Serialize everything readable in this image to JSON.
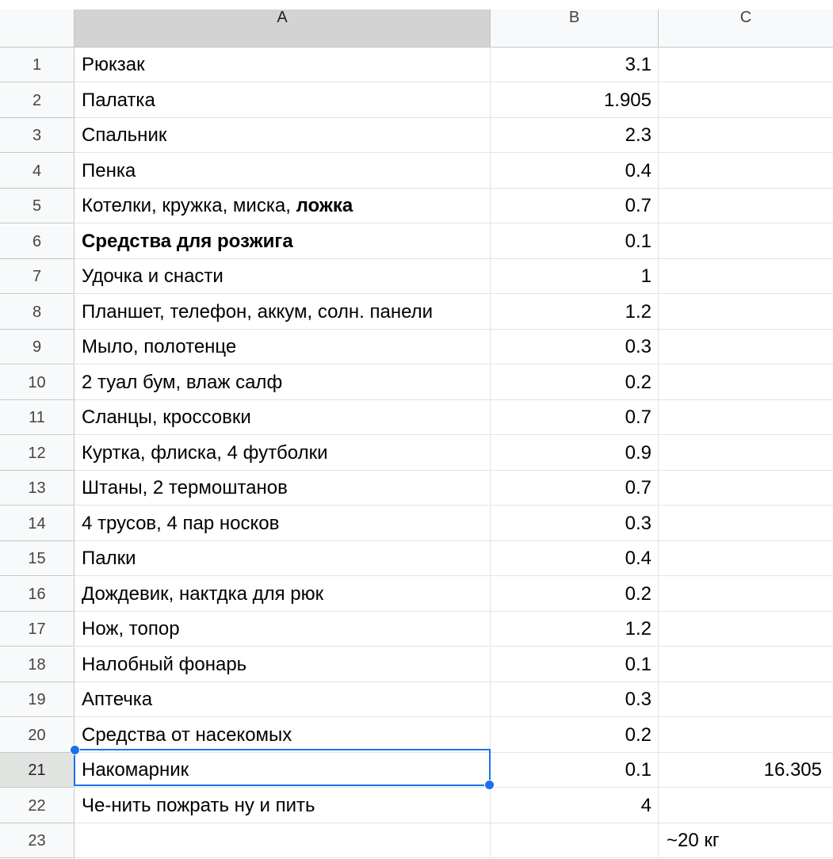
{
  "columns": [
    "A",
    "B",
    "C"
  ],
  "rows": [
    {
      "n": "1",
      "a": "Рюкзак",
      "b": "3.1",
      "c": ""
    },
    {
      "n": "2",
      "a": "Палатка",
      "b": "1.905",
      "c": ""
    },
    {
      "n": "3",
      "a": "Спальник",
      "b": "2.3",
      "c": ""
    },
    {
      "n": "4",
      "a": "Пенка",
      "b": "0.4",
      "c": ""
    },
    {
      "n": "5",
      "a": "Котелки, кружка, миска, ",
      "a_bold": "ложка",
      "b": "0.7",
      "c": ""
    },
    {
      "n": "6",
      "a": "",
      "a_bold": "Средства для розжига",
      "b": "0.1",
      "c": ""
    },
    {
      "n": "7",
      "a": "Удочка и снасти",
      "b": "1",
      "c": ""
    },
    {
      "n": "8",
      "a": "Планшет, телефон, аккум, солн. панели",
      "b": "1.2",
      "c": ""
    },
    {
      "n": "9",
      "a": "Мыло, полотенце",
      "b": "0.3",
      "c": ""
    },
    {
      "n": "10",
      "a": "2 туал бум, влаж салф",
      "b": "0.2",
      "c": ""
    },
    {
      "n": "11",
      "a": "Сланцы, кроссовки",
      "b": "0.7",
      "c": ""
    },
    {
      "n": "12",
      "a": "Куртка, флиска, 4 футболки",
      "b": "0.9",
      "c": ""
    },
    {
      "n": "13",
      "a": "Штаны, 2 термоштанов",
      "b": "0.7",
      "c": ""
    },
    {
      "n": "14",
      "a": "4 трусов, 4 пар носков",
      "b": "0.3",
      "c": ""
    },
    {
      "n": "15",
      "a": "Палки",
      "b": "0.4",
      "c": ""
    },
    {
      "n": "16",
      "a": "Дождевик, нактдка для рюк",
      "b": "0.2",
      "c": ""
    },
    {
      "n": "17",
      "a": "Нож, топор",
      "b": "1.2",
      "c": ""
    },
    {
      "n": "18",
      "a": "Налобный фонарь",
      "b": "0.1",
      "c": ""
    },
    {
      "n": "19",
      "a": "Аптечка",
      "b": "0.3",
      "c": ""
    },
    {
      "n": "20",
      "a": "Средства от насекомых",
      "b": "0.2",
      "c": ""
    },
    {
      "n": "21",
      "a": "Накомарник",
      "b": "0.1",
      "c": "16.305",
      "active": true
    },
    {
      "n": "22",
      "a": "Че-нить пожрать ну и пить",
      "b": "4",
      "c": ""
    },
    {
      "n": "23",
      "a": "",
      "b": "",
      "c": "~20 кг",
      "c_left": true
    }
  ],
  "selected_cell": "A21",
  "colors": {
    "selection": "#1a73e8",
    "header_bg": "#f8f9fa",
    "active_header_bg": "#d3d3d3",
    "gridline": "#e2e3e3"
  }
}
